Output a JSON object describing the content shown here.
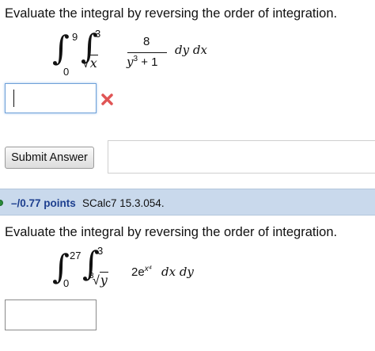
{
  "q1": {
    "prompt": "Evaluate the integral by reversing the order of integration.",
    "outer_upper": "9",
    "outer_lower": "0",
    "inner_upper": "3",
    "inner_lower_radicand": "x",
    "numerator": "8",
    "denominator_base": "y",
    "denominator_exp": "3",
    "denominator_rest": "+ 1",
    "differentials": "dy dx",
    "answer_value": "",
    "status_icon": "x-mark-icon",
    "status_color": "#e05555"
  },
  "submit": {
    "label": "Submit Answer"
  },
  "q2_header": {
    "points": "–/0.77 points",
    "reference": "SCalc7 15.3.054."
  },
  "q2": {
    "prompt": "Evaluate the integral by reversing the order of integration.",
    "outer_upper": "27",
    "outer_lower": "0",
    "inner_upper": "3",
    "inner_lower_index": "3",
    "inner_lower_radicand": "y",
    "integrand_coef": "2e",
    "integrand_exp": "x⁴",
    "differentials": "dx dy",
    "answer_value": ""
  }
}
